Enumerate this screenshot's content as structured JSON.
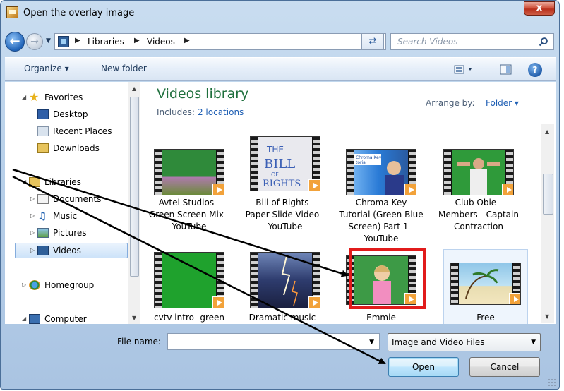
{
  "window": {
    "title": "Open the overlay image",
    "close_label": "x"
  },
  "address": {
    "crumbs": [
      "Libraries",
      "Videos"
    ],
    "search_placeholder": "Search Videos"
  },
  "toolbar": {
    "organize": "Organize ▾",
    "new_folder": "New folder"
  },
  "nav": {
    "favorites": "Favorites",
    "desktop": "Desktop",
    "recent_places": "Recent Places",
    "downloads": "Downloads",
    "libraries": "Libraries",
    "documents": "Documents",
    "music": "Music",
    "pictures": "Pictures",
    "videos": "Videos",
    "homegroup": "Homegroup",
    "computer": "Computer"
  },
  "library": {
    "title": "Videos library",
    "includes_label": "Includes:",
    "locations_link": "2 locations",
    "arrange_label": "Arrange by:",
    "arrange_value": "Folder ▾"
  },
  "videos": [
    {
      "label": "Avtel Studios - Green Screen Mix - YouTube",
      "color": "#2f8a3a"
    },
    {
      "label": "Bill of Rights - Paper Slide Video - YouTube",
      "color": "#e9e9ee"
    },
    {
      "label": "Chroma Key Tutorial (Green Blue Screen) Part 1 - YouTube",
      "color": "#2a7bd6"
    },
    {
      "label": "Club Obie - Members - Captain Contraction",
      "color": "#2f9a3a"
    },
    {
      "label": "cvtv intro- green",
      "color": "#1fa22d"
    },
    {
      "label": "Dramatic music -",
      "color": "#3a4b8a"
    },
    {
      "label": "Emmie",
      "color": "#3d9a46"
    },
    {
      "label": "Free",
      "color": "#8fc6e8"
    }
  ],
  "bottom": {
    "file_name_label": "File name:",
    "file_name_value": "",
    "file_type": "Image and Video Files",
    "open_label": "Open",
    "cancel_label": "Cancel"
  },
  "colors": {
    "highlight": "#e11b1b",
    "library_title": "#1e6f3c",
    "link": "#1f5fb4"
  }
}
